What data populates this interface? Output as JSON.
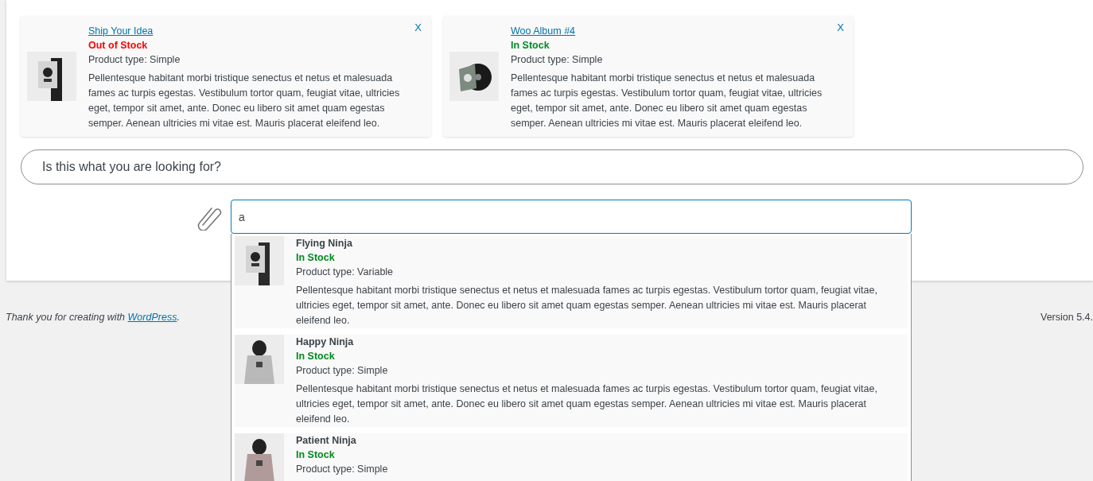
{
  "cards": [
    {
      "title": "Ship Your Idea",
      "in_stock": false,
      "status": "Out of Stock",
      "type": "Product type: Simple",
      "description": "Pellentesque habitant morbi tristique senectus et netus et malesuada fames ac turpis egestas. Vestibulum tortor quam, feugiat vitae, ultricies eget, tempor sit amet, ante. Donec eu libero sit amet quam egestas semper. Aenean ultricies mi vitae est. Mauris placerat eleifend leo.",
      "close": "X"
    },
    {
      "title": "Woo Album #4",
      "in_stock": true,
      "status": "In Stock",
      "type": "Product type: Simple",
      "description": "Pellentesque habitant morbi tristique senectus et netus et malesuada fames ac turpis egestas. Vestibulum tortor quam, feugiat vitae, ultricies eget, tempor sit amet, ante. Donec eu libero sit amet quam egestas semper. Aenean ultricies mi vitae est. Mauris placerat eleifend leo.",
      "close": "X"
    }
  ],
  "message": "Is this what you are looking for?",
  "search": {
    "value": "a"
  },
  "suggestions": [
    {
      "title": "Flying Ninja",
      "in_stock": true,
      "status": "In Stock",
      "type": "Product type: Variable",
      "description": "Pellentesque habitant morbi tristique senectus et netus et malesuada fames ac turpis egestas. Vestibulum tortor quam, feugiat vitae, ultricies eget, tempor sit amet, ante. Donec eu libero sit amet quam egestas semper. Aenean ultricies mi vitae est. Mauris placerat eleifend leo."
    },
    {
      "title": "Happy Ninja",
      "in_stock": true,
      "status": "In Stock",
      "type": "Product type: Simple",
      "description": "Pellentesque habitant morbi tristique senectus et netus et malesuada fames ac turpis egestas. Vestibulum tortor quam, feugiat vitae, ultricies eget, tempor sit amet, ante. Donec eu libero sit amet quam egestas semper. Aenean ultricies mi vitae est. Mauris placerat eleifend leo."
    },
    {
      "title": "Patient Ninja",
      "in_stock": true,
      "status": "In Stock",
      "type": "Product type: Simple"
    }
  ],
  "footer": {
    "text": "Thank you for creating with",
    "link": "WordPress",
    "suffix": ".",
    "version": "Version 5.4."
  }
}
